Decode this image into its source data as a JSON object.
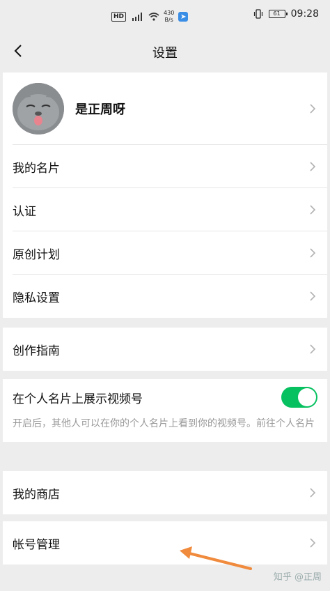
{
  "status_bar": {
    "hd": "HD",
    "net_speed_value": "430",
    "net_speed_unit": "B/s",
    "battery": "61",
    "time": "09:28"
  },
  "nav": {
    "title": "设置"
  },
  "profile": {
    "name": "是正周呀"
  },
  "group1": {
    "items": [
      "我的名片",
      "认证",
      "原创计划",
      "隐私设置"
    ]
  },
  "group2": {
    "items": [
      "创作指南"
    ]
  },
  "group3": {
    "toggle_label": "在个人名片上展示视频号",
    "toggle_on": true,
    "description": "开启后，其他人可以在你的个人名片上看到你的视频号。前往个人名片"
  },
  "group4": {
    "items": [
      "我的商店"
    ]
  },
  "group5": {
    "items": [
      "帐号管理"
    ]
  },
  "colors": {
    "toggle": "#07c160",
    "arrow": "#f08a3c",
    "background": "#ededed"
  },
  "watermark": "知乎 @正周"
}
